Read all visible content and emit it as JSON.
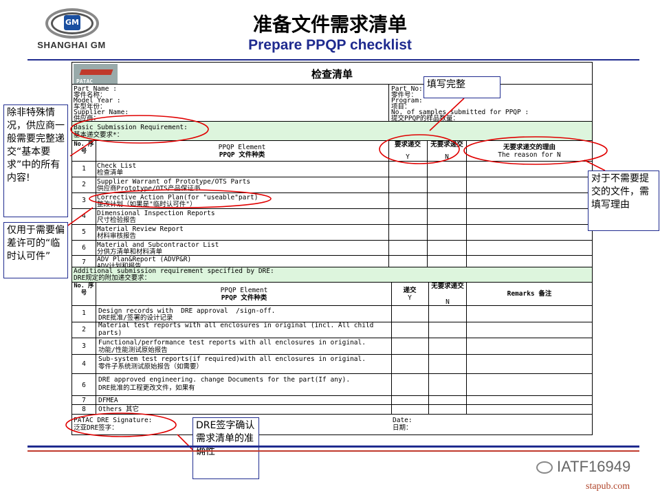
{
  "header": {
    "logo_text": "SHANGHAI GM",
    "logo_badge": "GM",
    "title_cn": "准备文件需求清单",
    "title_en": "Prepare PPQP checklist"
  },
  "form": {
    "brand": "PATAC",
    "title": "检查清单",
    "left_info": [
      "Part Name :",
      "零件名称：",
      "Model Year :",
      "车型年份：",
      "Supplier Name:",
      "供应商："
    ],
    "right_info": [
      "Part No:",
      "零件号：",
      "Program:",
      "项目：",
      "No. of samples submitted for PPQP :",
      "提交PPQP的样品数量："
    ],
    "basic": {
      "en": "Basic Submission Requirement:",
      "cn": "基本递交要求*："
    },
    "table1": {
      "col_no": "No. 序号",
      "col_element_en": "PPQP Element",
      "col_element_cn": "PPQP 文件种类",
      "col_y_cn": "要求递交",
      "col_y": "Y",
      "col_n_cn": "无要求递交",
      "col_n": "N",
      "col_reason_cn": "无要求递交的理由",
      "col_reason_en": "The reason for N",
      "rows": [
        {
          "no": "1",
          "en": "Check List",
          "cn": "检查清单"
        },
        {
          "no": "2",
          "en": "Supplier Warrant of Prototype/OTS Parts",
          "cn": "供应商Prototype/OTS产品保证书"
        },
        {
          "no": "3",
          "en": "Corrective Action Plan(for \"useable\"part)",
          "cn": "整改计划（如果是\"临时认可件\"）"
        },
        {
          "no": "4",
          "en": "Dimensional Inspection Reports",
          "cn": "尺寸检验报告"
        },
        {
          "no": "5",
          "en": "Material Review Report",
          "cn": "材料审核报告"
        },
        {
          "no": "6",
          "en": "Material and Subcontractor List",
          "cn": "分供方清单和材料清单"
        },
        {
          "no": "7",
          "en": "ADV Plan&Report (ADVP&R)",
          "cn": "ADV计划和报告"
        }
      ]
    },
    "additional": {
      "en": "Additional submission requirement specified by DRE:",
      "cn": "DRE规定的附加递交要求："
    },
    "table2": {
      "col_no": "No. 序号",
      "col_element_en": "PPQP Element",
      "col_element_cn": "PPQP 文件种类",
      "col_y_cn": "递交",
      "col_y": "Y",
      "col_n_cn": "无要求递交",
      "col_n": "N",
      "col_remarks": "Remarks 备注",
      "rows": [
        {
          "no": "1",
          "en": "Design records with  DRE approval  /sign-off.",
          "cn": "DRE批准/签署的设计记录"
        },
        {
          "no": "2",
          "en": "Material test reports with all enclosures in original (incl. All child",
          "cn": "parts)"
        },
        {
          "no": "3",
          "en": "Functional/performance test reports with all enclosures in original.",
          "cn": "功能/性能测试原始报告"
        },
        {
          "no": "4",
          "en": "Sub-system test reports(if required)with all enclosures in original.",
          "cn": "零件子系统测试原始报告（如需要）"
        },
        {
          "no": "6",
          "en": "DRE approved engineering. change Documents for the part(If any).",
          "cn": "DRE批准的工程更改文件，如果有"
        },
        {
          "no": "7",
          "en": "DFMEA",
          "cn": ""
        },
        {
          "no": "8",
          "en": "Others 其它",
          "cn": ""
        }
      ]
    },
    "signature": {
      "en": "PATAC DRE Signature:",
      "cn": "泛亚DRE签字：",
      "date_en": "Date:",
      "date_cn": "日期："
    }
  },
  "callouts": {
    "fill_complete": "填写完整",
    "basic_requirement": "除非特殊情况，供应商一般需要完整递交“基本要求”中的所有内容!",
    "deviation": "仅用于需要偏差许可的“临时认可件”",
    "reason_note": "对于不需要提交的文件，需填写理由",
    "dre_sign": "DRE签字确认需求清单的准确性"
  },
  "footer": {
    "watermark": "IATF16949",
    "watermark_icon": "wechat-icon",
    "site": "stapub.com"
  },
  "colors": {
    "accent_blue": "#1f2b8f",
    "annotation_red": "#e00000",
    "highlight_green": "#ddf5dd"
  }
}
